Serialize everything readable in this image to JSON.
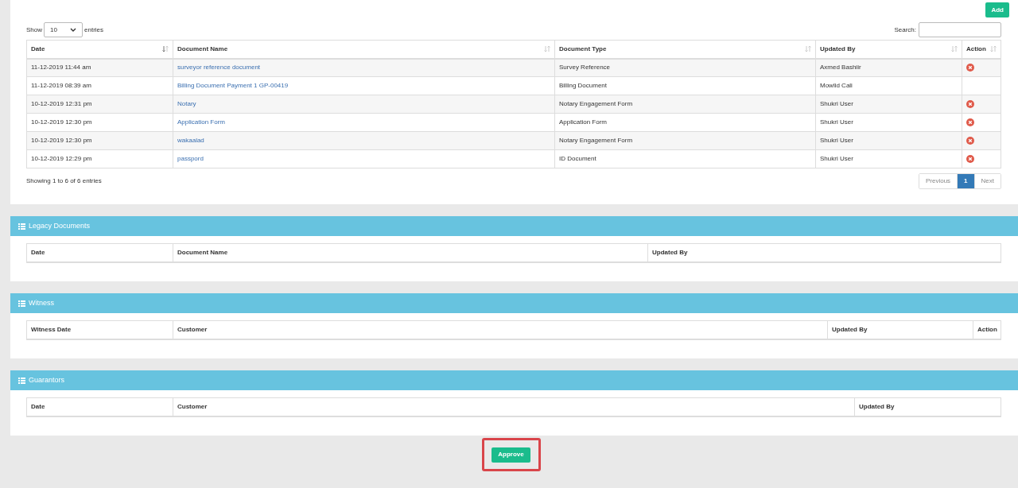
{
  "add_button": "Add",
  "length": {
    "label_before": "Show",
    "value": "10",
    "label_after": "entries"
  },
  "search": {
    "label": "Search:"
  },
  "documents": {
    "columns": [
      {
        "label": "Date",
        "sorted": true
      },
      {
        "label": "Document Name",
        "sorted": false
      },
      {
        "label": "Document Type",
        "sorted": false
      },
      {
        "label": "Updated By",
        "sorted": false
      },
      {
        "label": "Action",
        "sorted": false
      }
    ],
    "rows": [
      {
        "date": "11-12-2019 11:44 am",
        "name": "surveyor reference document",
        "type": "Survey Reference",
        "updated_by": "Axmed Bashiir",
        "deletable": true
      },
      {
        "date": "11-12-2019 08:39 am",
        "name": "Billing Document Payment 1 GP-00419",
        "type": "Billing Document",
        "updated_by": "Mowlid Cali",
        "deletable": false
      },
      {
        "date": "10-12-2019 12:31 pm",
        "name": "Notary",
        "type": "Notary Engagement Form",
        "updated_by": "Shukri User",
        "deletable": true
      },
      {
        "date": "10-12-2019 12:30 pm",
        "name": "Application Form",
        "type": "Application Form",
        "updated_by": "Shukri User",
        "deletable": true
      },
      {
        "date": "10-12-2019 12:30 pm",
        "name": "wakaalad",
        "type": "Notary Engagement Form",
        "updated_by": "Shukri User",
        "deletable": true
      },
      {
        "date": "10-12-2019 12:29 pm",
        "name": "passpord",
        "type": "ID Document",
        "updated_by": "Shukri User",
        "deletable": true
      }
    ],
    "info": "Showing 1 to 6 of 6 entries",
    "pagination": [
      {
        "label": "Previous",
        "selected": false,
        "disabled": true
      },
      {
        "label": "1",
        "selected": true,
        "disabled": false
      },
      {
        "label": "Next",
        "selected": false,
        "disabled": true
      }
    ]
  },
  "panels": [
    {
      "title": "Legacy Documents",
      "columns": [
        "Date",
        "Document Name",
        "Updated By"
      ]
    },
    {
      "title": "Witness",
      "columns": [
        "Witness Date",
        "Customer",
        "Updated By",
        "Action"
      ]
    },
    {
      "title": "Guarantors",
      "columns": [
        "Date",
        "Customer",
        "Updated By"
      ]
    }
  ],
  "approve_button": "Approve"
}
